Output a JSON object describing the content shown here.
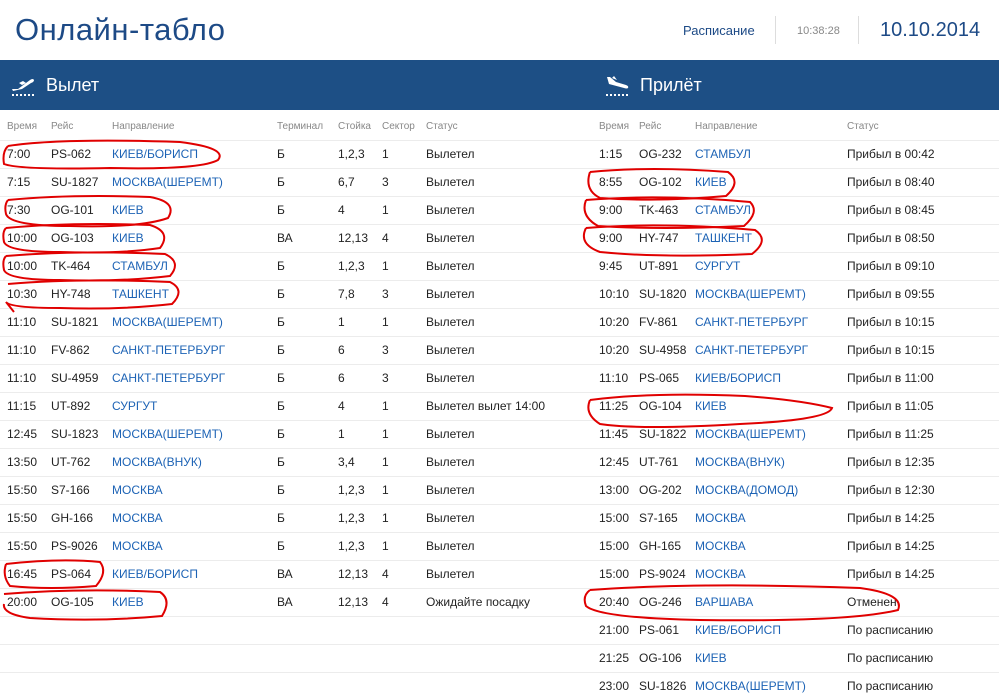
{
  "header": {
    "title": "Онлайн-табло",
    "schedule_link": "Расписание",
    "time": "10:38:28",
    "date": "10.10.2014"
  },
  "departures": {
    "title": "Вылет",
    "columns": [
      "Время",
      "Рейс",
      "Направление",
      "Терминал",
      "Стойка",
      "Сектор",
      "Статус"
    ],
    "rows": [
      {
        "time": "7:00",
        "flight": "PS-062",
        "dest": "КИЕВ/БОРИСП",
        "term": "Б",
        "desk": "1,2,3",
        "sector": "1",
        "status": "Вылетел"
      },
      {
        "time": "7:15",
        "flight": "SU-1827",
        "dest": "МОСКВА(ШЕРЕМТ)",
        "term": "Б",
        "desk": "6,7",
        "sector": "3",
        "status": "Вылетел"
      },
      {
        "time": "7:30",
        "flight": "OG-101",
        "dest": "КИЕВ",
        "term": "Б",
        "desk": "4",
        "sector": "1",
        "status": "Вылетел"
      },
      {
        "time": "10:00",
        "flight": "OG-103",
        "dest": "КИЕВ",
        "term": "ВА",
        "desk": "12,13",
        "sector": "4",
        "status": "Вылетел"
      },
      {
        "time": "10:00",
        "flight": "TK-464",
        "dest": "СТАМБУЛ",
        "term": "Б",
        "desk": "1,2,3",
        "sector": "1",
        "status": "Вылетел"
      },
      {
        "time": "10:30",
        "flight": "HY-748",
        "dest": "ТАШКЕНТ",
        "term": "Б",
        "desk": "7,8",
        "sector": "3",
        "status": "Вылетел"
      },
      {
        "time": "11:10",
        "flight": "SU-1821",
        "dest": "МОСКВА(ШЕРЕМТ)",
        "term": "Б",
        "desk": "1",
        "sector": "1",
        "status": "Вылетел"
      },
      {
        "time": "11:10",
        "flight": "FV-862",
        "dest": "САНКТ-ПЕТЕРБУРГ",
        "term": "Б",
        "desk": "6",
        "sector": "3",
        "status": "Вылетел"
      },
      {
        "time": "11:10",
        "flight": "SU-4959",
        "dest": "САНКТ-ПЕТЕРБУРГ",
        "term": "Б",
        "desk": "6",
        "sector": "3",
        "status": "Вылетел"
      },
      {
        "time": "11:15",
        "flight": "UT-892",
        "dest": "СУРГУТ",
        "term": "Б",
        "desk": "4",
        "sector": "1",
        "status": "Вылетел вылет 14:00"
      },
      {
        "time": "12:45",
        "flight": "SU-1823",
        "dest": "МОСКВА(ШЕРЕМТ)",
        "term": "Б",
        "desk": "1",
        "sector": "1",
        "status": "Вылетел"
      },
      {
        "time": "13:50",
        "flight": "UT-762",
        "dest": "МОСКВА(ВНУК)",
        "term": "Б",
        "desk": "3,4",
        "sector": "1",
        "status": "Вылетел"
      },
      {
        "time": "15:50",
        "flight": "S7-166",
        "dest": "МОСКВА",
        "term": "Б",
        "desk": "1,2,3",
        "sector": "1",
        "status": "Вылетел"
      },
      {
        "time": "15:50",
        "flight": "GH-166",
        "dest": "МОСКВА",
        "term": "Б",
        "desk": "1,2,3",
        "sector": "1",
        "status": "Вылетел"
      },
      {
        "time": "15:50",
        "flight": "PS-9026",
        "dest": "МОСКВА",
        "term": "Б",
        "desk": "1,2,3",
        "sector": "1",
        "status": "Вылетел"
      },
      {
        "time": "16:45",
        "flight": "PS-064",
        "dest": "КИЕВ/БОРИСП",
        "term": "ВА",
        "desk": "12,13",
        "sector": "4",
        "status": "Вылетел"
      },
      {
        "time": "20:00",
        "flight": "OG-105",
        "dest": "КИЕВ",
        "term": "ВА",
        "desk": "12,13",
        "sector": "4",
        "status": "Ожидайте посадку"
      }
    ]
  },
  "arrivals": {
    "title": "Прилёт",
    "columns": [
      "Время",
      "Рейс",
      "Направление",
      "Статус"
    ],
    "rows": [
      {
        "time": "1:15",
        "flight": "OG-232",
        "dest": "СТАМБУЛ",
        "status": "Прибыл в 00:42"
      },
      {
        "time": "8:55",
        "flight": "OG-102",
        "dest": "КИЕВ",
        "status": "Прибыл в 08:40"
      },
      {
        "time": "9:00",
        "flight": "TK-463",
        "dest": "СТАМБУЛ",
        "status": "Прибыл в 08:45"
      },
      {
        "time": "9:00",
        "flight": "HY-747",
        "dest": "ТАШКЕНТ",
        "status": "Прибыл в 08:50"
      },
      {
        "time": "9:45",
        "flight": "UT-891",
        "dest": "СУРГУТ",
        "status": "Прибыл в 09:10"
      },
      {
        "time": "10:10",
        "flight": "SU-1820",
        "dest": "МОСКВА(ШЕРЕМТ)",
        "status": "Прибыл в 09:55"
      },
      {
        "time": "10:20",
        "flight": "FV-861",
        "dest": "САНКТ-ПЕТЕРБУРГ",
        "status": "Прибыл в 10:15"
      },
      {
        "time": "10:20",
        "flight": "SU-4958",
        "dest": "САНКТ-ПЕТЕРБУРГ",
        "status": "Прибыл в 10:15"
      },
      {
        "time": "11:10",
        "flight": "PS-065",
        "dest": "КИЕВ/БОРИСП",
        "status": "Прибыл в 11:00"
      },
      {
        "time": "11:25",
        "flight": "OG-104",
        "dest": "КИЕВ",
        "status": "Прибыл в 11:05"
      },
      {
        "time": "11:45",
        "flight": "SU-1822",
        "dest": "МОСКВА(ШЕРЕМТ)",
        "status": "Прибыл в 11:25"
      },
      {
        "time": "12:45",
        "flight": "UT-761",
        "dest": "МОСКВА(ВНУК)",
        "status": "Прибыл в 12:35"
      },
      {
        "time": "13:00",
        "flight": "OG-202",
        "dest": "МОСКВА(ДОМОД)",
        "status": "Прибыл в 12:30"
      },
      {
        "time": "15:00",
        "flight": "S7-165",
        "dest": "МОСКВА",
        "status": "Прибыл в 14:25"
      },
      {
        "time": "15:00",
        "flight": "GH-165",
        "dest": "МОСКВА",
        "status": "Прибыл в 14:25"
      },
      {
        "time": "15:00",
        "flight": "PS-9024",
        "dest": "МОСКВА",
        "status": "Прибыл в 14:25"
      },
      {
        "time": "20:40",
        "flight": "OG-246",
        "dest": "ВАРШАВА",
        "status": "Отменен"
      },
      {
        "time": "21:00",
        "flight": "PS-061",
        "dest": "КИЕВ/БОРИСП",
        "status": "По расписанию"
      },
      {
        "time": "21:25",
        "flight": "OG-106",
        "dest": "КИЕВ",
        "status": "По расписанию"
      },
      {
        "time": "23:00",
        "flight": "SU-1826",
        "dest": "МОСКВА(ШЕРЕМТ)",
        "status": "По расписанию"
      }
    ]
  },
  "colors": {
    "brand": "#1d4f85",
    "link": "#1d63b5",
    "annotation": "#e00000"
  },
  "icons": {
    "departure": "plane-takeoff-icon",
    "arrival": "plane-landing-icon"
  }
}
